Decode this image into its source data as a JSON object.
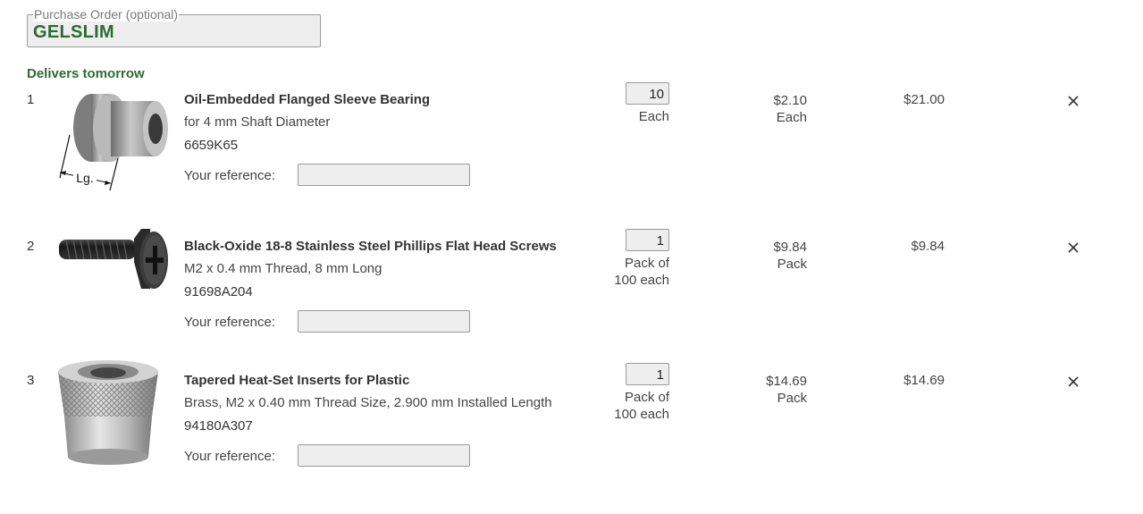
{
  "purchase_order": {
    "label": "Purchase Order (optional)",
    "value": "GELSLIM"
  },
  "delivery_note": "Delivers tomorrow",
  "reference_label": "Your reference:",
  "items": [
    {
      "index": "1",
      "title": "Oil-Embedded Flanged Sleeve Bearing",
      "spec": "for 4 mm Shaft Diameter",
      "part_number": "6659K65",
      "image_icon": "flanged-sleeve-bearing",
      "image_label": "Lg.",
      "quantity": "10",
      "unit_lines": [
        "Each"
      ],
      "unit_price": "$2.10",
      "price_unit": "Each",
      "line_total": "$21.00"
    },
    {
      "index": "2",
      "title": "Black-Oxide 18-8 Stainless Steel Phillips Flat Head Screws",
      "spec": "M2 x 0.4 mm Thread, 8 mm Long",
      "part_number": "91698A204",
      "image_icon": "flat-head-screw",
      "quantity": "1",
      "unit_lines": [
        "Pack of",
        "100 each"
      ],
      "unit_price": "$9.84",
      "price_unit": "Pack",
      "line_total": "$9.84"
    },
    {
      "index": "3",
      "title": "Tapered Heat-Set Inserts for Plastic",
      "spec": "Brass, M2 x 0.40 mm Thread Size, 2.900 mm Installed Length",
      "part_number": "94180A307",
      "image_icon": "heat-set-insert",
      "quantity": "1",
      "unit_lines": [
        "Pack of",
        "100 each"
      ],
      "unit_price": "$14.69",
      "price_unit": "Pack",
      "line_total": "$14.69"
    }
  ],
  "remove_icon": "close-icon",
  "colors": {
    "accent_green": "#2e6b34",
    "field_bg": "#eeeeee",
    "field_border": "#9a9a9a"
  }
}
